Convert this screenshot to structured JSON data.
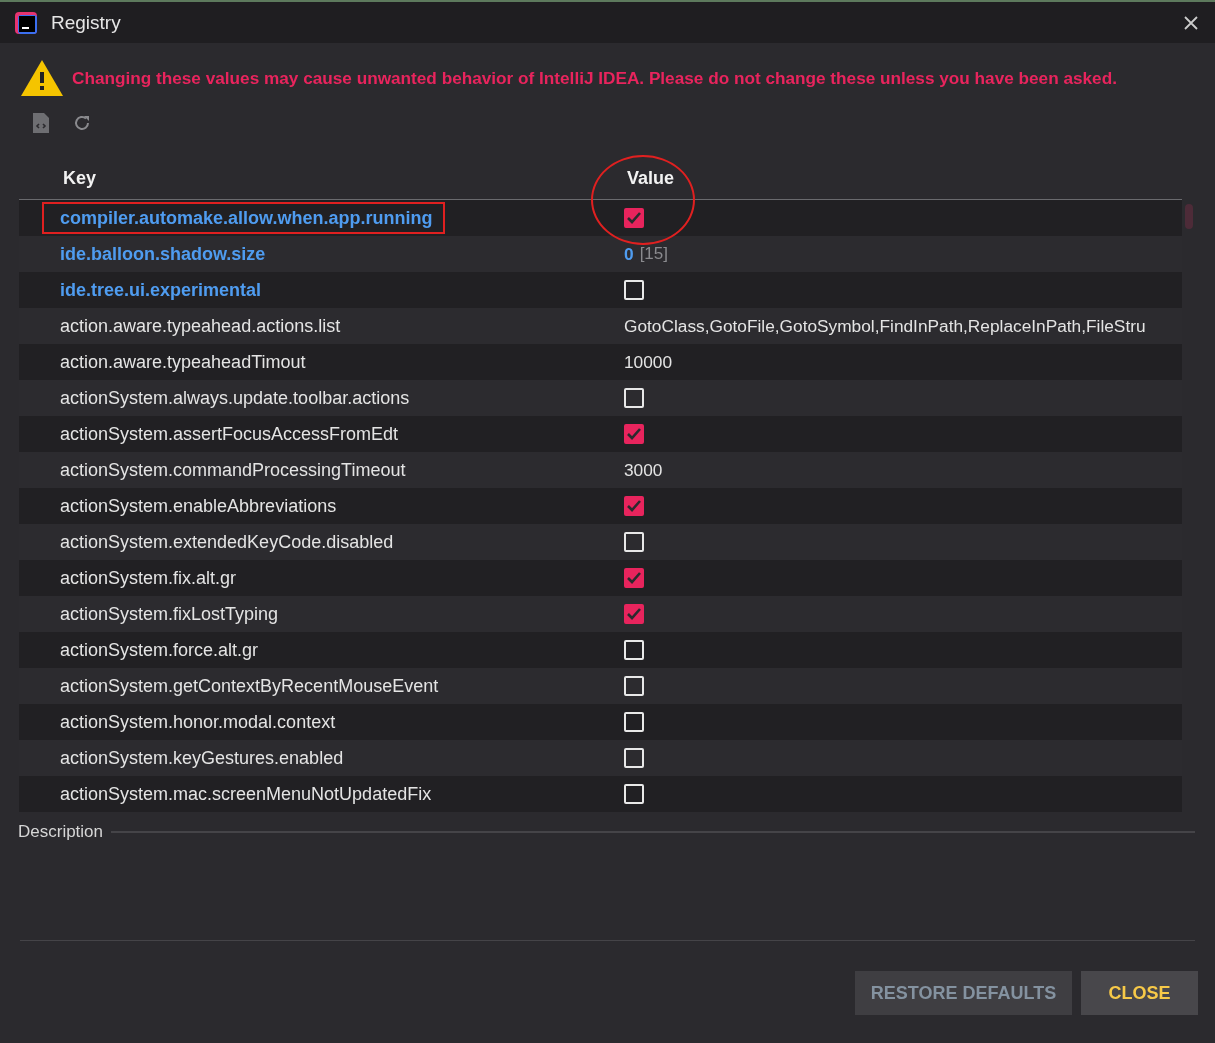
{
  "window": {
    "title": "Registry"
  },
  "warning": "Changing these values may cause unwanted behavior of IntelliJ IDEA. Please do not change these unless you have been asked.",
  "table": {
    "columns": [
      "Key",
      "Value"
    ],
    "rows": [
      {
        "key": "compiler.automake.allow.when.app.running",
        "modified": true,
        "kind": "checkbox",
        "checked": true,
        "highlighted": true
      },
      {
        "key": "ide.balloon.shadow.size",
        "modified": true,
        "kind": "number",
        "value": "0",
        "default": "[15]"
      },
      {
        "key": "ide.tree.ui.experimental",
        "modified": true,
        "kind": "checkbox",
        "checked": false
      },
      {
        "key": "action.aware.typeahead.actions.list",
        "modified": false,
        "kind": "text",
        "value": "GotoClass,GotoFile,GotoSymbol,FindInPath,ReplaceInPath,FileStru"
      },
      {
        "key": "action.aware.typeaheadTimout",
        "modified": false,
        "kind": "text",
        "value": "10000"
      },
      {
        "key": "actionSystem.always.update.toolbar.actions",
        "modified": false,
        "kind": "checkbox",
        "checked": false
      },
      {
        "key": "actionSystem.assertFocusAccessFromEdt",
        "modified": false,
        "kind": "checkbox",
        "checked": true
      },
      {
        "key": "actionSystem.commandProcessingTimeout",
        "modified": false,
        "kind": "text",
        "value": "3000"
      },
      {
        "key": "actionSystem.enableAbbreviations",
        "modified": false,
        "kind": "checkbox",
        "checked": true
      },
      {
        "key": "actionSystem.extendedKeyCode.disabled",
        "modified": false,
        "kind": "checkbox",
        "checked": false
      },
      {
        "key": "actionSystem.fix.alt.gr",
        "modified": false,
        "kind": "checkbox",
        "checked": true
      },
      {
        "key": "actionSystem.fixLostTyping",
        "modified": false,
        "kind": "checkbox",
        "checked": true
      },
      {
        "key": "actionSystem.force.alt.gr",
        "modified": false,
        "kind": "checkbox",
        "checked": false
      },
      {
        "key": "actionSystem.getContextByRecentMouseEvent",
        "modified": false,
        "kind": "checkbox",
        "checked": false
      },
      {
        "key": "actionSystem.honor.modal.context",
        "modified": false,
        "kind": "checkbox",
        "checked": false
      },
      {
        "key": "actionSystem.keyGestures.enabled",
        "modified": false,
        "kind": "checkbox",
        "checked": false
      },
      {
        "key": "actionSystem.mac.screenMenuNotUpdatedFix",
        "modified": false,
        "kind": "checkbox",
        "checked": false
      }
    ]
  },
  "description_label": "Description",
  "buttons": [
    {
      "label": "RESTORE DEFAULTS",
      "kind": "secondary"
    },
    {
      "label": "CLOSE",
      "kind": "primary"
    }
  ]
}
